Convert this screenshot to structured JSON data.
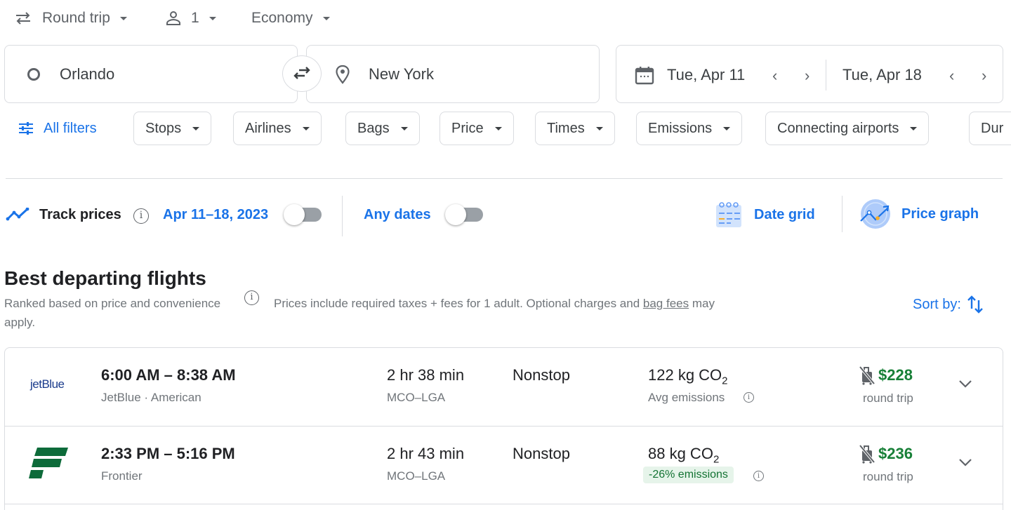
{
  "top_bar": {
    "trip_type": "Round trip",
    "passengers": "1",
    "cabin": "Economy"
  },
  "search": {
    "origin": "Orlando",
    "destination": "New York",
    "depart_date": "Tue, Apr 11",
    "return_date": "Tue, Apr 18"
  },
  "filters": {
    "all_filters": "All filters",
    "chips": [
      "Stops",
      "Airlines",
      "Bags",
      "Price",
      "Times",
      "Emissions",
      "Connecting airports",
      "Dur"
    ]
  },
  "tracking": {
    "track_prices": "Track prices",
    "date_range": "Apr 11–18, 2023",
    "track_toggle_on": false,
    "any_dates": "Any dates",
    "any_dates_toggle_on": false,
    "date_grid": "Date grid",
    "price_graph": "Price graph"
  },
  "results": {
    "title": "Best departing flights",
    "ranked_note": "Ranked based on price and convenience",
    "price_note_pre": "Prices include required taxes + fees for 1 adult. Optional charges and ",
    "bag_fees_link": "bag fees",
    "price_note_post": " may",
    "price_note_wrap": "apply.",
    "sort_by": "Sort by:",
    "flights": [
      {
        "airline_logo": "jetBlue",
        "times": "6:00 AM – 8:38 AM",
        "airlines": "JetBlue · American",
        "duration": "2 hr 38 min",
        "route": "MCO–LGA",
        "stops": "Nonstop",
        "emissions_value": "122 kg CO",
        "emissions_sub": "2",
        "emissions_note": "Avg emissions",
        "price": "$228",
        "price_type": "round trip"
      },
      {
        "airline_logo": "frontier-logo",
        "times": "2:33 PM – 5:16 PM",
        "airlines": "Frontier",
        "duration": "2 hr 43 min",
        "route": "MCO–LGA",
        "stops": "Nonstop",
        "emissions_value": "88 kg CO",
        "emissions_sub": "2",
        "emissions_note": "-26% emissions",
        "price": "$236",
        "price_type": "round trip"
      }
    ]
  },
  "colors": {
    "accent": "#1a73e8",
    "price_green": "#188038",
    "eco_badge_bg": "#e6f4ea",
    "frontier_green": "#0d6b3a",
    "jetblue_navy": "#1a3b8c"
  }
}
